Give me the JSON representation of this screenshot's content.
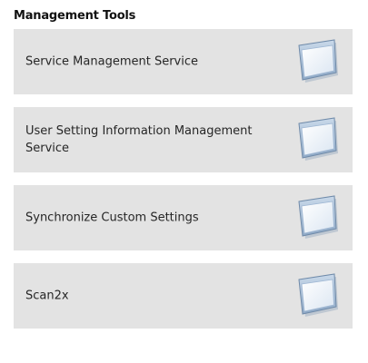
{
  "section": {
    "title": "Management Tools"
  },
  "tools": [
    {
      "label": "Service Management Service",
      "icon": "application-window-icon"
    },
    {
      "label": "User Setting Information Management Service",
      "icon": "application-window-icon"
    },
    {
      "label": "Synchronize Custom Settings",
      "icon": "application-window-icon"
    },
    {
      "label": "Scan2x",
      "icon": "application-window-icon"
    }
  ],
  "colors": {
    "tile_background": "#e3e3e3",
    "icon_frame": "#9fb7d3",
    "icon_body": "#f4f8fc"
  }
}
